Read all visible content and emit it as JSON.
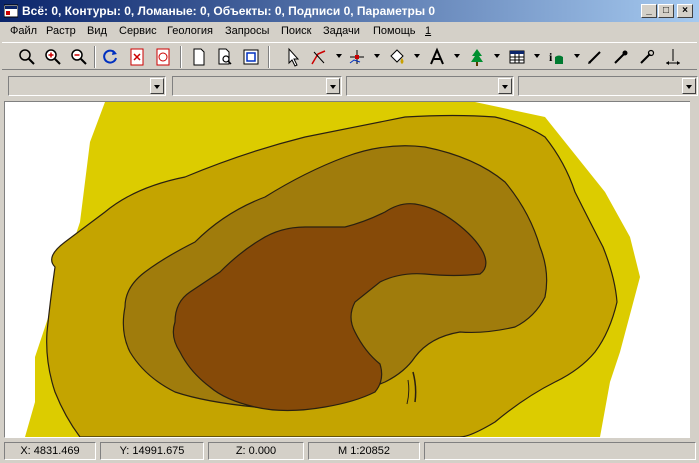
{
  "window": {
    "title": "Всё: 0, Контуры: 0, Ломаные: 0, Объекты: 0, Подписи 0, Параметры 0",
    "controls": {
      "minimize": "_",
      "maximize": "□",
      "close": "×"
    }
  },
  "menu": {
    "items": [
      "Файл",
      "Растр",
      "Вид",
      "Сервис",
      "Геология",
      "Запросы",
      "Поиск",
      "Задачи",
      "Помощь",
      "1"
    ]
  },
  "toolbar": {
    "icons": [
      "zoom-icon",
      "zoom-in-icon",
      "zoom-out-icon",
      "refresh-icon",
      "delete-frame-icon",
      "delete-map-icon",
      "new-page-icon",
      "page-preview-icon",
      "frame-icon",
      "pointer-icon",
      "line-tool-icon",
      "node-edit-icon",
      "fill-icon",
      "text-tool-icon",
      "tree-symbol-icon",
      "table-icon",
      "well-symbol-icon",
      "pencil-icon",
      "eyedropper-icon",
      "eyedropper-alt-icon",
      "measure-icon"
    ]
  },
  "combos": [
    {
      "value": ""
    },
    {
      "value": ""
    },
    {
      "value": ""
    },
    {
      "value": ""
    }
  ],
  "map": {
    "colors": {
      "outer": "#dccc00",
      "mid": "#c4a400",
      "inner": "#a07c0c",
      "core": "#864a08",
      "outline": "#2a2010"
    }
  },
  "status": {
    "x": "X: 4831.469",
    "y": "Y: 14991.675",
    "z": "Z: 0.000",
    "scale": "M 1:20852"
  }
}
